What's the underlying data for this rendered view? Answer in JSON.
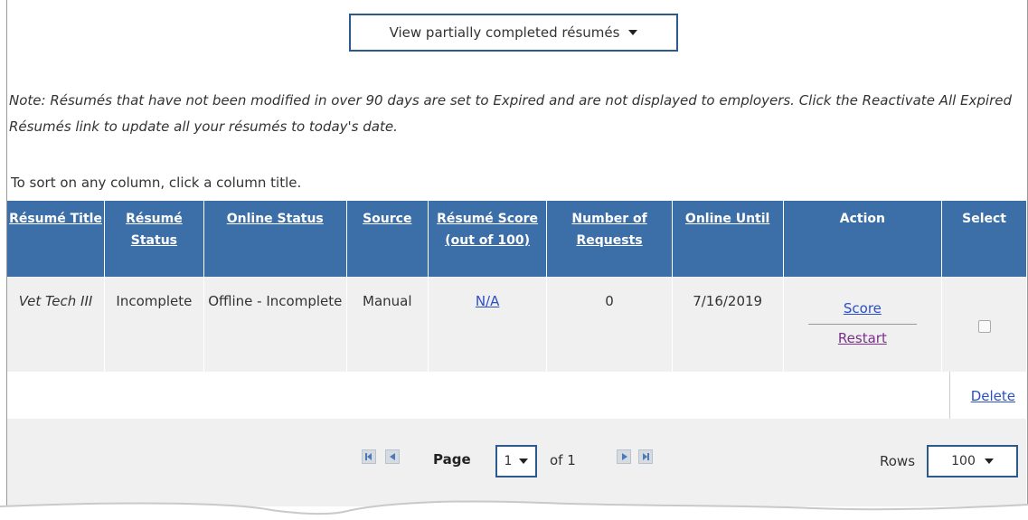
{
  "view_select": {
    "label": "View partially completed résumés"
  },
  "note": "Note: Résumés that have not been modified in over 90 days are set to Expired and are not displayed to employers. Click the Reactivate All Expired Résumés link to update all your résumés to today's date.",
  "sort_hint": "To sort on any column, click a column title.",
  "table": {
    "headers": {
      "title": "Résumé Title",
      "status": "Résumé Status",
      "online_status": "Online Status",
      "source": "Source",
      "score": "Résumé Score (out of 100)",
      "requests": "Number of Requests",
      "online_until": "Online Until",
      "action": "Action",
      "select": "Select"
    },
    "rows": [
      {
        "title": "Vet Tech III",
        "status": "Incomplete",
        "online_status": "Offline - Incomplete",
        "source": "Manual",
        "score": "N/A",
        "requests": "0",
        "online_until": "7/16/2019",
        "actions": {
          "score": "Score",
          "restart": "Restart"
        },
        "selected": false
      }
    ],
    "delete_label": "Delete"
  },
  "pager": {
    "page_label": "Page",
    "page_value": "1",
    "of_label": "of 1",
    "rows_label": "Rows",
    "rows_value": "100"
  },
  "colors": {
    "header_bg": "#3c6fa8",
    "row_bg": "#f0f0f0",
    "link": "#2b4fc7",
    "visited_link": "#7a3089",
    "select_border": "#2d5a8c"
  }
}
